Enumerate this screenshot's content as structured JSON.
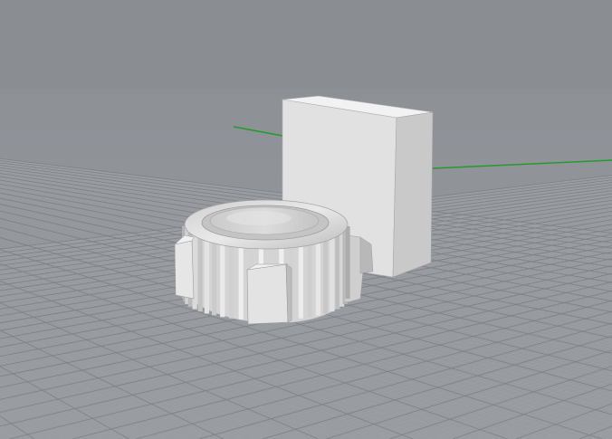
{
  "viewport": {
    "projection": "perspective",
    "background": "#8a8e93",
    "grid": {
      "visible": true,
      "minor_color": "#9ea1a6",
      "major_color": "#7e8287"
    },
    "axes": {
      "x_color": "#1f9c2a",
      "y_color": "#1f9c2a"
    },
    "objects": [
      {
        "type": "box",
        "color": "#e5e5e5"
      },
      {
        "type": "gear-cylinder",
        "color": "#d8d8d8"
      }
    ]
  }
}
